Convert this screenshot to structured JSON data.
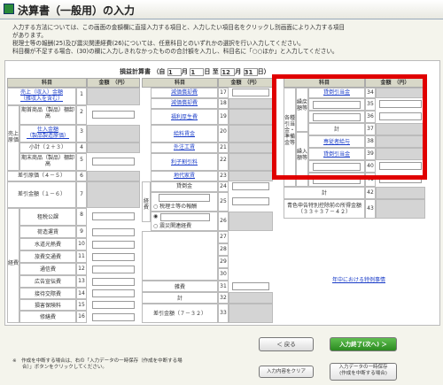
{
  "window": {
    "title": "決算書（一般用）の入力"
  },
  "instructions": [
    "入力する方法については、この画面の金額欄に直接入力する項目と、入力したい項目名をクリックし別画面により入力する項目",
    "があります。",
    "税理士等の報酬(25)及び震災関連経費(26)については、任意科目とのいずれかの選択を行い入力してください。",
    "科目欄が不足する場合、(30)の欄に入力しきれなかったものの合計額を入力し、科目名に「○○ほか」と入力してください。"
  ],
  "statement": {
    "title": "損益計算書",
    "from_label": "（自",
    "month1": "1",
    "month_label": "月",
    "day1": "1",
    "day_label": "日",
    "to_label": "至",
    "month2": "12",
    "day2": "31",
    "end_label": "日）"
  },
  "headers": {
    "item": "科目",
    "amount": "金額　（円）"
  },
  "left": {
    "sales": "売上（収入）金額",
    "sales_sub": "（雑収入を含む）",
    "group_cost": "売上原価",
    "opening_inv": "期首商品（製品）棚卸高",
    "purchases": "仕入金額",
    "purchases_sub": "（製品製造原価）",
    "subtotal": "小計（２＋３）",
    "closing_inv": "期末商品（製品）棚卸高",
    "cost": "差引原価（４－５）",
    "gross": "差引金額（１－６）",
    "group_exp": "経費",
    "exp": [
      "租税公課",
      "荷造運賃",
      "水道光熱費",
      "旅費交通費",
      "通信費",
      "広告宣伝費",
      "接待交際費",
      "損害保険料",
      "修繕費"
    ]
  },
  "mid": {
    "exp": [
      "減価償却費",
      "福利厚生費",
      "給料賃金",
      "外注工賃",
      "利子割引料",
      "地代家賃",
      "貸倒金"
    ],
    "link_exp": [
      "減価償却費",
      "福利厚生費",
      "給料賃金",
      "外注工賃",
      "利子割引料",
      "地代家賃"
    ],
    "plain": "減価償却費",
    "radio1": "税理士等の報酬",
    "radio2": "震災関連経費",
    "misc": "雑費",
    "total": "計",
    "diff": "差引金額（７－３２）"
  },
  "right": {
    "group1": "各種引当金・準備金等",
    "sub_inflow": "繰戻額等",
    "sub_outflow": "繰入額等",
    "allowance1": "貸倒引当金",
    "reserve1": "専従者給与",
    "allowance2": "貸倒引当金",
    "total1": "計",
    "before_label": "青色申告特別控除前の所得金額",
    "before_formula": "（３３＋３７－４２）",
    "mid_year": "年中における特例事情"
  },
  "nums": {
    "l": [
      "1",
      "2",
      "3",
      "4",
      "5",
      "6",
      "7",
      "8",
      "9",
      "10",
      "11",
      "12",
      "13",
      "14",
      "15",
      "16"
    ],
    "m": [
      "17",
      "18",
      "19",
      "20",
      "21",
      "22",
      "23",
      "24",
      "25",
      "26",
      "27",
      "28",
      "29",
      "30",
      "31",
      "32",
      "33"
    ],
    "r": [
      "34",
      "35",
      "36",
      "37",
      "38",
      "39",
      "40",
      "41",
      "42",
      "43"
    ]
  },
  "buttons": {
    "back": "＜ 戻る",
    "next": "入力終了(次へ) ＞",
    "clear": "入力内容をクリア",
    "save": "入力データの一時保存",
    "save2": "(作成を中断する場合)"
  },
  "footnote": [
    "※　作成を中断する場合は、右の「入力データの一時保存（作成を中断する場",
    "　　合）」ボタンをクリックしてください。"
  ]
}
